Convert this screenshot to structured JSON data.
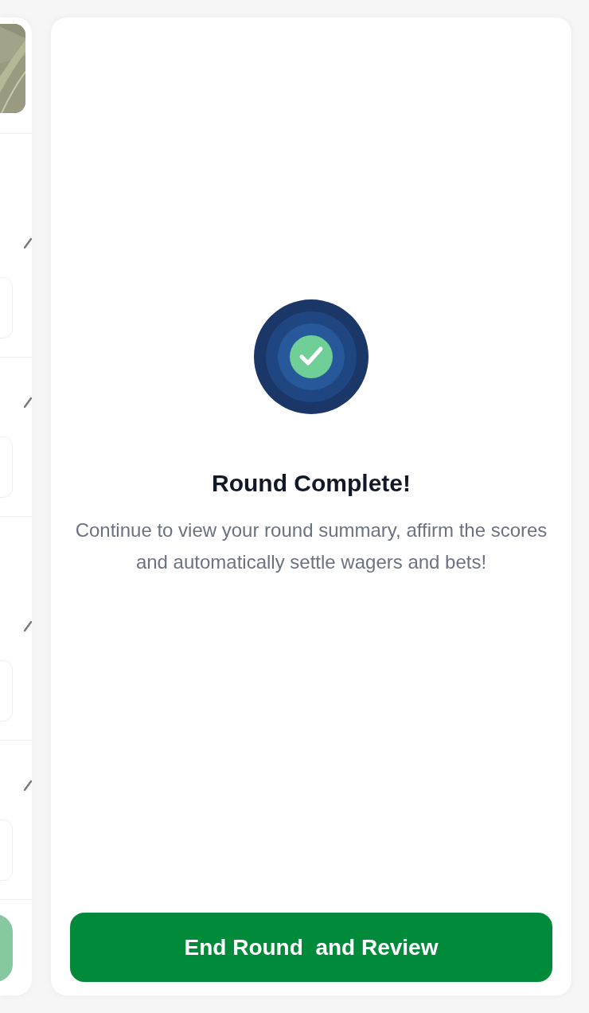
{
  "side_panel": {
    "rows": [
      {
        "kind": "tall"
      },
      {
        "kind": "short"
      },
      {
        "kind": "tall"
      },
      {
        "kind": "short"
      }
    ]
  },
  "dialog": {
    "title": "Round Complete!",
    "message": "Continue to view your round summary, affirm the scores and automatically settle wagers and bets!",
    "button": "End Round  and Review"
  }
}
